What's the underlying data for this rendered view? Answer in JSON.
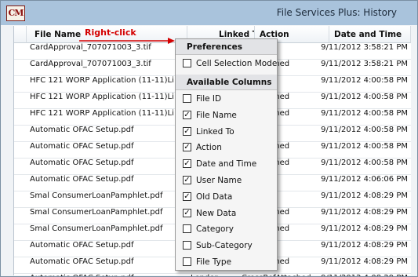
{
  "app": {
    "icon_text": "CM",
    "title": "File Services Plus: History"
  },
  "annotation": {
    "text": "Right-click",
    "color": "#d40000"
  },
  "columns": [
    "File Name",
    "Linked To",
    "Action",
    "Date and Time"
  ],
  "rows": [
    [
      "CardApproval_707071003_3.tif",
      "",
      "dded",
      "9/11/2012 3:58:21 PM"
    ],
    [
      "CardApproval_707071003_3.tif",
      "",
      "RefAttached",
      "9/11/2012 3:58:21 PM"
    ],
    [
      "HFC 121 WORP Application (11-11)Li",
      "",
      "dded",
      "9/11/2012 4:00:58 PM"
    ],
    [
      "HFC 121 WORP Application (11-11)Li",
      "",
      "RefAttached",
      "9/11/2012 4:00:58 PM"
    ],
    [
      "HFC 121 WORP Application (11-11)Li",
      "",
      "RefAttached",
      "9/11/2012 4:00:58 PM"
    ],
    [
      "Automatic OFAC Setup.pdf",
      "",
      "dded",
      "9/11/2012 4:00:58 PM"
    ],
    [
      "Automatic OFAC Setup.pdf",
      "",
      "RefAttached",
      "9/11/2012 4:00:58 PM"
    ],
    [
      "Automatic OFAC Setup.pdf",
      "",
      "RefAttached",
      "9/11/2012 4:00:58 PM"
    ],
    [
      "Automatic OFAC Setup.pdf",
      "",
      "eleted",
      "9/11/2012 4:06:06 PM"
    ],
    [
      "Smal ConsumerLoanPamphlet.pdf",
      "",
      "dded",
      "9/11/2012 4:08:29 PM"
    ],
    [
      "Smal ConsumerLoanPamphlet.pdf",
      "",
      "RefAttached",
      "9/11/2012 4:08:29 PM"
    ],
    [
      "Smal ConsumerLoanPamphlet.pdf",
      "",
      "RefAttached",
      "9/11/2012 4:08:29 PM"
    ],
    [
      "Automatic OFAC Setup.pdf",
      "",
      "dded",
      "9/11/2012 4:08:29 PM"
    ],
    [
      "Automatic OFAC Setup.pdf",
      "",
      "RefAttached",
      "9/11/2012 4:08:29 PM"
    ],
    [
      "Automatic OFAC Setup.pdf",
      "Lender",
      "CrossRefAttached",
      "9/11/2012 4:08:29 PM"
    ]
  ],
  "menu": {
    "header": "Preferences",
    "cell_selection": {
      "label": "Cell Selection Mode",
      "checked": false
    },
    "section_label": "Available Columns",
    "items": [
      {
        "label": "File ID",
        "checked": false
      },
      {
        "label": "File Name",
        "checked": true
      },
      {
        "label": "Linked To",
        "checked": true
      },
      {
        "label": "Action",
        "checked": true
      },
      {
        "label": "Date and Time",
        "checked": true
      },
      {
        "label": "User Name",
        "checked": true
      },
      {
        "label": "Old Data",
        "checked": true
      },
      {
        "label": "New Data",
        "checked": true
      },
      {
        "label": "Category",
        "checked": false
      },
      {
        "label": "Sub-Category",
        "checked": false
      },
      {
        "label": "File Type",
        "checked": false
      }
    ]
  }
}
